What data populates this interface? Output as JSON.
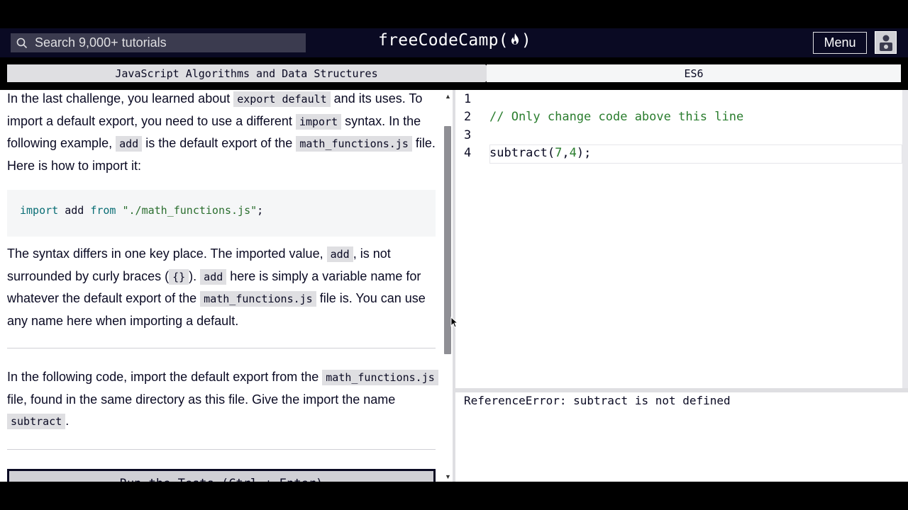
{
  "nav": {
    "search_placeholder": "Search 9,000+ tutorials",
    "brand_left": "freeCodeCamp(",
    "brand_right": ")",
    "menu_label": "Menu",
    "colors": {
      "nav_bg": "#0a0a23",
      "search_bg": "#3b3b4f"
    }
  },
  "breadcrumb": {
    "superblock": "JavaScript Algorithms and Data Structures",
    "block": "ES6"
  },
  "description": {
    "p1": {
      "t1": "In the last challenge, you learned about ",
      "c1": "export default",
      "t2": " and its uses. To import a default export, you need to use a different ",
      "c2": "import",
      "t3": " syntax. In the following example, ",
      "c3": "add",
      "t4": " is the default export of the ",
      "c4": "math_functions.js",
      "t5": " file. Here is how to import it:"
    },
    "code_example": {
      "kw_import": "import",
      "ident": " add ",
      "kw_from": "from",
      "string": " \"./math_functions.js\"",
      "semi": ";"
    },
    "p2": {
      "t1": "The syntax differs in one key place. The imported value, ",
      "c1": "add",
      "t2": ", is not surrounded by curly braces (",
      "c2": "{}",
      "t3": "). ",
      "c3": "add",
      "t4": " here is simply a variable name for whatever the default export of the ",
      "c4": "math_functions.js",
      "t5": " file is. You can use any name here when importing a default."
    },
    "instructions": {
      "t1": "In the following code, import the default export from the ",
      "c1": "math_functions.js",
      "t2": " file, found in the same directory as this file. Give the import the name ",
      "c2": "subtract",
      "t3": "."
    },
    "run_button": "Run the Tests (Ctrl + Enter)"
  },
  "editor": {
    "line_numbers": [
      "1",
      "2",
      "3",
      "4"
    ],
    "line2_comment": "// Only change code above this line",
    "line4": {
      "fn": "subtract(",
      "a": "7",
      "comma": ",",
      "b": "4",
      "end": ");"
    }
  },
  "console": {
    "output": "ReferenceError: subtract is not defined"
  }
}
